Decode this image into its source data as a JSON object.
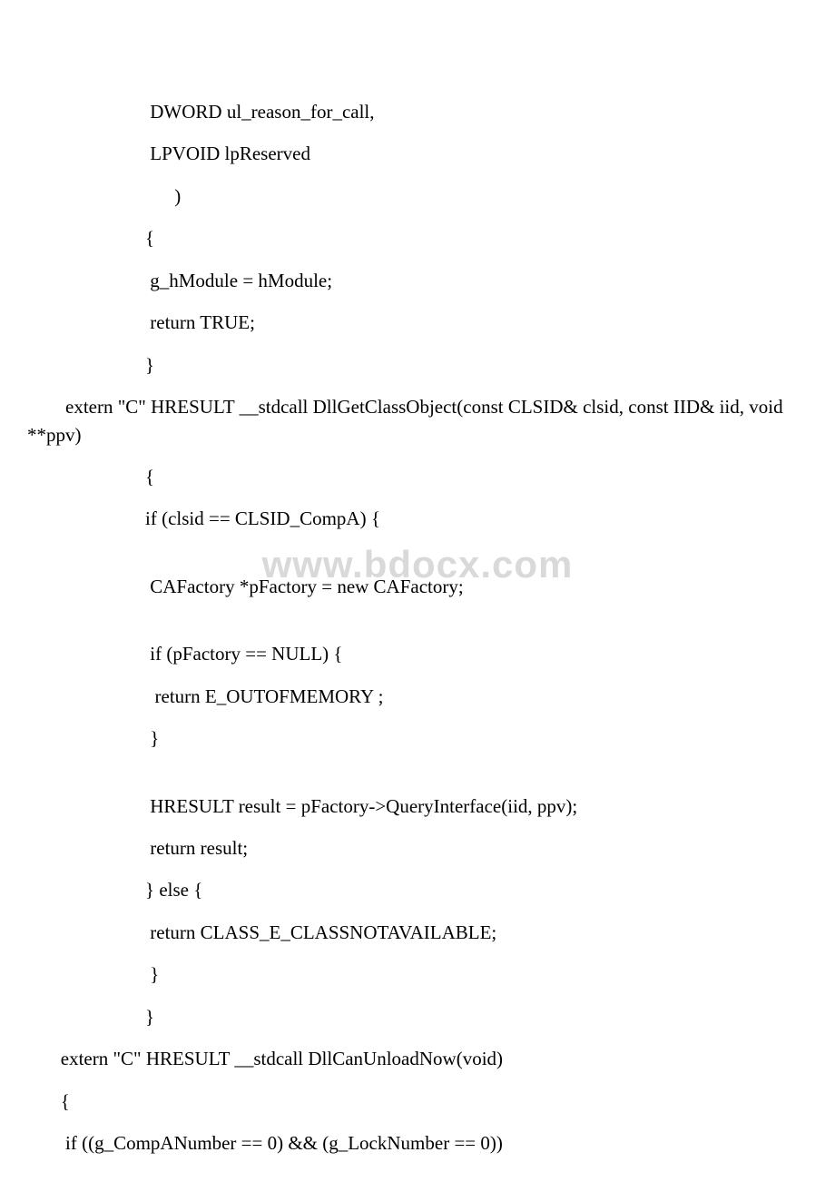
{
  "watermark": "www.bdocx.com",
  "lines": [
    {
      "cls": "indent1",
      "text": " DWORD ul_reason_for_call,"
    },
    {
      "cls": "indent1",
      "text": " LPVOID lpReserved"
    },
    {
      "cls": "indent1b",
      "text": " )"
    },
    {
      "cls": "indent1",
      "text": "{"
    },
    {
      "cls": "indent1",
      "text": " g_hModule = hModule;"
    },
    {
      "cls": "indent1",
      "text": " return TRUE;"
    },
    {
      "cls": "indent1",
      "text": "}"
    },
    {
      "cls": "indent0",
      "text": "        extern \"C\" HRESULT __stdcall DllGetClassObject(const CLSID& clsid, const IID& iid, void **ppv)"
    },
    {
      "cls": "indent1",
      "text": "{"
    },
    {
      "cls": "indent1",
      "text": "if (clsid == CLSID_CompA) {"
    },
    {
      "cls": "spacer",
      "text": ""
    },
    {
      "cls": "indent1",
      "text": " CAFactory *pFactory = new CAFactory;"
    },
    {
      "cls": "spacer",
      "text": ""
    },
    {
      "cls": "indent1",
      "text": " if (pFactory == NULL) {"
    },
    {
      "cls": "indent1",
      "text": "  return E_OUTOFMEMORY ;"
    },
    {
      "cls": "indent1",
      "text": " }"
    },
    {
      "cls": "spacer",
      "text": ""
    },
    {
      "cls": "indent1",
      "text": " HRESULT result = pFactory->QueryInterface(iid, ppv);"
    },
    {
      "cls": "indent1",
      "text": " return result;"
    },
    {
      "cls": "indent1",
      "text": "} else {"
    },
    {
      "cls": "indent1",
      "text": " return CLASS_E_CLASSNOTAVAILABLE;"
    },
    {
      "cls": "indent1",
      "text": " }"
    },
    {
      "cls": "indent1",
      "text": "}"
    },
    {
      "cls": "indent0",
      "text": "       extern \"C\" HRESULT __stdcall DllCanUnloadNow(void)"
    },
    {
      "cls": "indent0",
      "text": "       {"
    },
    {
      "cls": "indent0",
      "text": "        if ((g_CompANumber == 0) && (g_LockNumber == 0))"
    }
  ]
}
